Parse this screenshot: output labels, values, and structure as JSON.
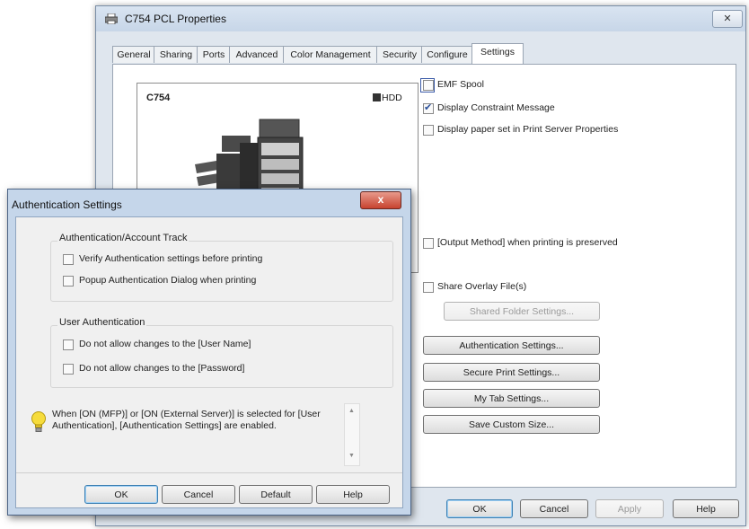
{
  "main_window": {
    "title": "C754 PCL Properties",
    "close_symbol": "✕",
    "tabs": [
      {
        "label": "General"
      },
      {
        "label": "Sharing"
      },
      {
        "label": "Ports"
      },
      {
        "label": "Advanced"
      },
      {
        "label": "Color Management"
      },
      {
        "label": "Security"
      },
      {
        "label": "Configure"
      },
      {
        "label": "Settings"
      }
    ],
    "active_tab": "Settings",
    "preview": {
      "model": "C754",
      "hdd_badge": "HDD"
    },
    "info_symbol": "i",
    "options": [
      {
        "label": "EMF Spool",
        "checked": false
      },
      {
        "label": "Display Constraint Message",
        "checked": true
      },
      {
        "label": "Display paper set in Print Server Properties",
        "checked": false
      },
      {
        "label": "[Output Method] when printing is preserved",
        "checked": false
      },
      {
        "label": "Share Overlay File(s)",
        "checked": false
      }
    ],
    "buttons": {
      "shared_folder": "Shared Folder Settings...",
      "authentication": "Authentication Settings...",
      "secure_print": "Secure Print Settings...",
      "my_tab": "My Tab Settings...",
      "save_custom_size": "Save Custom Size...",
      "ok": "OK",
      "cancel": "Cancel",
      "apply": "Apply",
      "help": "Help"
    }
  },
  "auth_dialog": {
    "title": "Authentication Settings",
    "close_symbol": "x",
    "group1": {
      "title": "Authentication/Account Track",
      "options": [
        {
          "label": "Verify Authentication settings before printing",
          "checked": false
        },
        {
          "label": "Popup Authentication Dialog when printing",
          "checked": false
        }
      ]
    },
    "group2": {
      "title": "User Authentication",
      "options": [
        {
          "label": "Do not allow changes to the [User Name]",
          "checked": false
        },
        {
          "label": "Do not allow changes to the [Password]",
          "checked": false
        }
      ]
    },
    "message": "When [ON (MFP)] or [ON (External Server)] is selected for [User Authentication], [Authentication Settings] are enabled.",
    "buttons": {
      "ok": "OK",
      "cancel": "Cancel",
      "default": "Default",
      "help": "Help"
    }
  },
  "colors": {
    "accent": "#3c7fb1",
    "close_red": "#c7432f",
    "window_frame": "#c5d6ea"
  }
}
